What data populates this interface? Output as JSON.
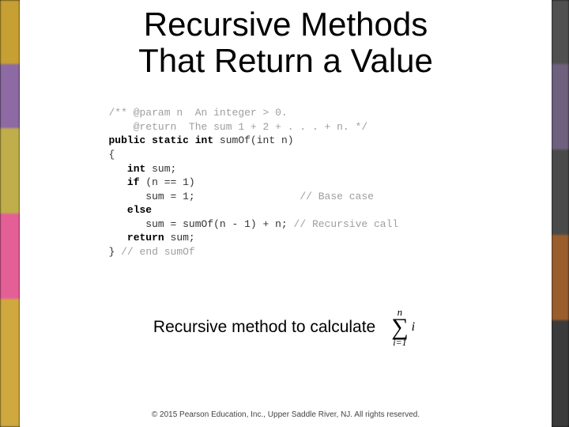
{
  "title_line1": "Recursive Methods",
  "title_line2": "That Return a Value",
  "code": {
    "l1a": "/** @param n  An integer > 0.",
    "l1b": "    @return  The sum 1 + 2 + . . . + n. */",
    "l2_kw": "public static int",
    "l2_rest": " sumOf(int n)",
    "l3": "{",
    "l4_kw": "   int",
    "l4_rest": " sum;",
    "l5_kw": "   if",
    "l5_rest": " (n == 1)",
    "l6": "      sum = 1;",
    "l6_cm": "                 // Base case",
    "l7_kw": "   else",
    "l8": "      sum = sumOf(n - 1) + n;",
    "l8_cm": " // Recursive call",
    "l9": "",
    "l10_kw": "   return",
    "l10_rest": " sum;",
    "l11": "}",
    "l11_cm": " // end sumOf"
  },
  "caption": "Recursive method to calculate",
  "formula": {
    "upper": "n",
    "lower": "i=1",
    "var": "i"
  },
  "copyright": "© 2015 Pearson Education, Inc., Upper Saddle River, NJ.  All rights reserved."
}
